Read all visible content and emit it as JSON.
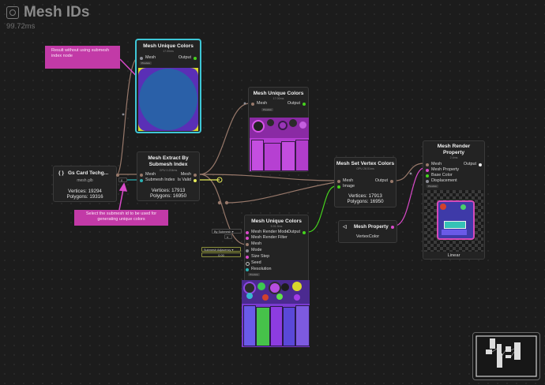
{
  "app": {
    "title": "Mesh IDs",
    "time": "99.72ms"
  },
  "notes": {
    "top": "Result without using submesh index node",
    "bottom": "Select the submesh id to be used for generating unique colors"
  },
  "gs_node": {
    "title": "Gs Card Techg...",
    "file": "mesh.glb",
    "vertices": "Vertices: 19294",
    "polygons": "Polygons: 19316",
    "index_value": "0"
  },
  "extract_node": {
    "title": "Mesh Extract By Submesh Index",
    "timing": "GPU 0.204ms",
    "in_mesh": "Mesh",
    "in_index": "Submesh Index",
    "out_mesh": "Mesh",
    "out_valid": "Is Valid",
    "vertices": "Vertices: 17913",
    "polygons": "Polygons: 16950"
  },
  "umc_top": {
    "title": "Mesh Unique Colors",
    "timing": "17.00ms",
    "in_mesh": "Mesh",
    "output": "Output",
    "tag": "Preview"
  },
  "umc_mid": {
    "title": "Mesh Unique Colors",
    "timing": "17.00ms",
    "in_mesh": "Mesh",
    "output": "Output",
    "tag": "Preview"
  },
  "umc_bot": {
    "title": "Mesh Unique Colors",
    "timing": "5.91.9ms",
    "output": "Output",
    "tag": "Preview",
    "inputs": [
      "Mesh Render Mode",
      "Mesh Render Filter",
      "Mesh",
      "Mode",
      "Size Step",
      "Seed",
      "Resolution"
    ],
    "chip_mode": "By Submesh ▾",
    "chip_filter": "≡",
    "chip_adjacency": "Submesh Adjacency ▾",
    "chip_size": "0.00"
  },
  "setvc_node": {
    "title": "Mesh Set Vertex Colors",
    "timing": "GPU 28.51ms",
    "in_mesh": "Mesh",
    "in_image": "Image",
    "output": "Output",
    "vertices": "Vertices: 17913",
    "polygons": "Polygons: 16950"
  },
  "prop_node": {
    "title": "Mesh Property",
    "value": "VertexColor"
  },
  "render_node": {
    "title": "Mesh Render Property",
    "timing": "2.4ms",
    "output": "Output",
    "tag": "Preview",
    "inputs": [
      "Mesh",
      "Mesh Property",
      "Base Color",
      "Displacement"
    ],
    "footer": "Linear"
  },
  "colors": {
    "accent": "#3ec6d6",
    "note": "#c23aa7",
    "mesh_socket": "#97786a",
    "color_socket": "#46d31e",
    "property_socket": "#d94ac9"
  }
}
